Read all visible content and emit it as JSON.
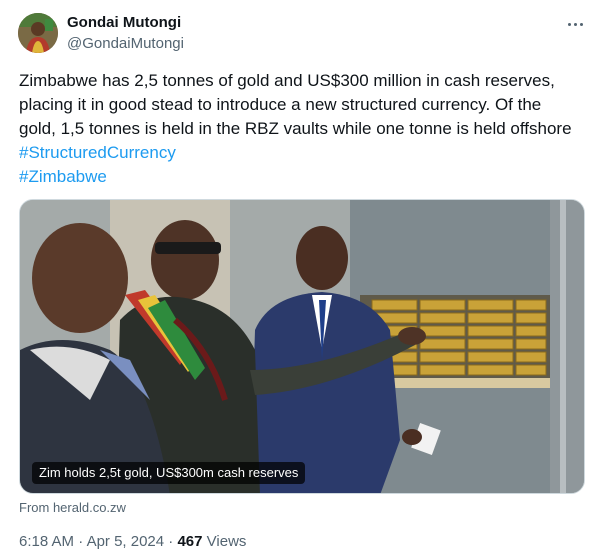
{
  "author": {
    "display_name": "Gondai Mutongi",
    "handle": "@GondaiMutongi",
    "avatar_icon": "profile-photo"
  },
  "more_icon": "more-options-icon",
  "tweet": {
    "text_lines": [
      "Zimbabwe has 2,5 tonnes of gold and US$300 million in cash reserves,",
      "placing it in good stead to introduce a new structured currency. Of the",
      "gold, 1,5 tonnes is held in the RBZ vaults while one tonne is held offshore"
    ],
    "hashtags": [
      "#StructuredCurrency",
      "#Zimbabwe"
    ]
  },
  "media": {
    "caption": "Zim holds 2,5t gold, US$300m cash reserves",
    "source": "From herald.co.zw"
  },
  "meta": {
    "time": "6:18 AM",
    "separator1": " · ",
    "date": "Apr 5, 2024",
    "separator2": " · ",
    "views_count": "467",
    "views_label": " Views"
  },
  "colors": {
    "link": "#1d9bf0",
    "secondary_text": "#536471",
    "primary_text": "#0f1419"
  }
}
